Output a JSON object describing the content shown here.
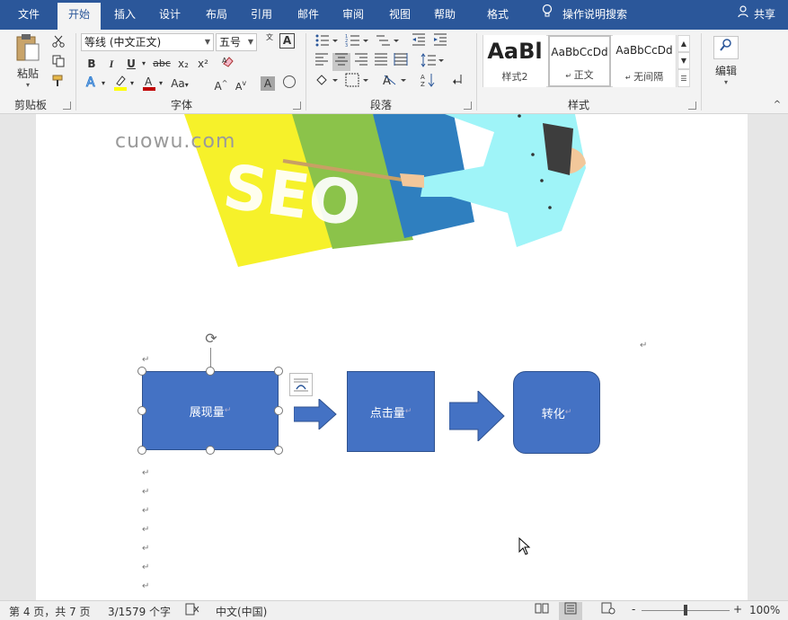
{
  "tabs": [
    {
      "label": "文件"
    },
    {
      "label": "开始",
      "active": true
    },
    {
      "label": "插入"
    },
    {
      "label": "设计"
    },
    {
      "label": "布局"
    },
    {
      "label": "引用"
    },
    {
      "label": "邮件"
    },
    {
      "label": "审阅"
    },
    {
      "label": "视图"
    },
    {
      "label": "帮助"
    },
    {
      "label": "格式"
    }
  ],
  "tell_me": "操作说明搜索",
  "share": "共享",
  "clipboard": {
    "paste": "粘贴",
    "group": "剪贴板"
  },
  "font": {
    "name": "等线 (中文正文)",
    "size": "五号",
    "wen_label": "文",
    "group": "字体",
    "bold": "B",
    "italic": "I",
    "underline": "U",
    "strike": "abc",
    "sub": "x₂",
    "sup": "x²",
    "grow": "A",
    "shrink": "A",
    "case": "Aa",
    "char_border": "A",
    "enclose": "字"
  },
  "paragraph": {
    "group": "段落"
  },
  "styles": {
    "group": "样式",
    "items": [
      {
        "preview": "AaBl",
        "name": "样式2"
      },
      {
        "preview": "AaBbCcDd",
        "name": "正文"
      },
      {
        "preview": "AaBbCcDd",
        "name": "无间隔"
      }
    ]
  },
  "editing": {
    "label": "编辑"
  },
  "document": {
    "watermark": "cuowu.com",
    "seo_text": "SEO",
    "flow": [
      {
        "label": "展现量"
      },
      {
        "label": "点击量"
      },
      {
        "label": "转化"
      }
    ],
    "paragraph_mark": "↵"
  },
  "status": {
    "page": "第 4 页，共 7 页",
    "words": "3/1579 个字",
    "language": "中文(中国)",
    "zoom": "100%",
    "minus": "-",
    "plus": "+"
  },
  "colors": {
    "accent": "#2b579a",
    "shape_fill": "#4472c4",
    "shape_border": "#2f528f",
    "seo_yellow": "#f6f12a",
    "seo_green": "#8bc34a",
    "seo_blue": "#2f7fbf",
    "seo_cyan": "#9ff4f8"
  }
}
